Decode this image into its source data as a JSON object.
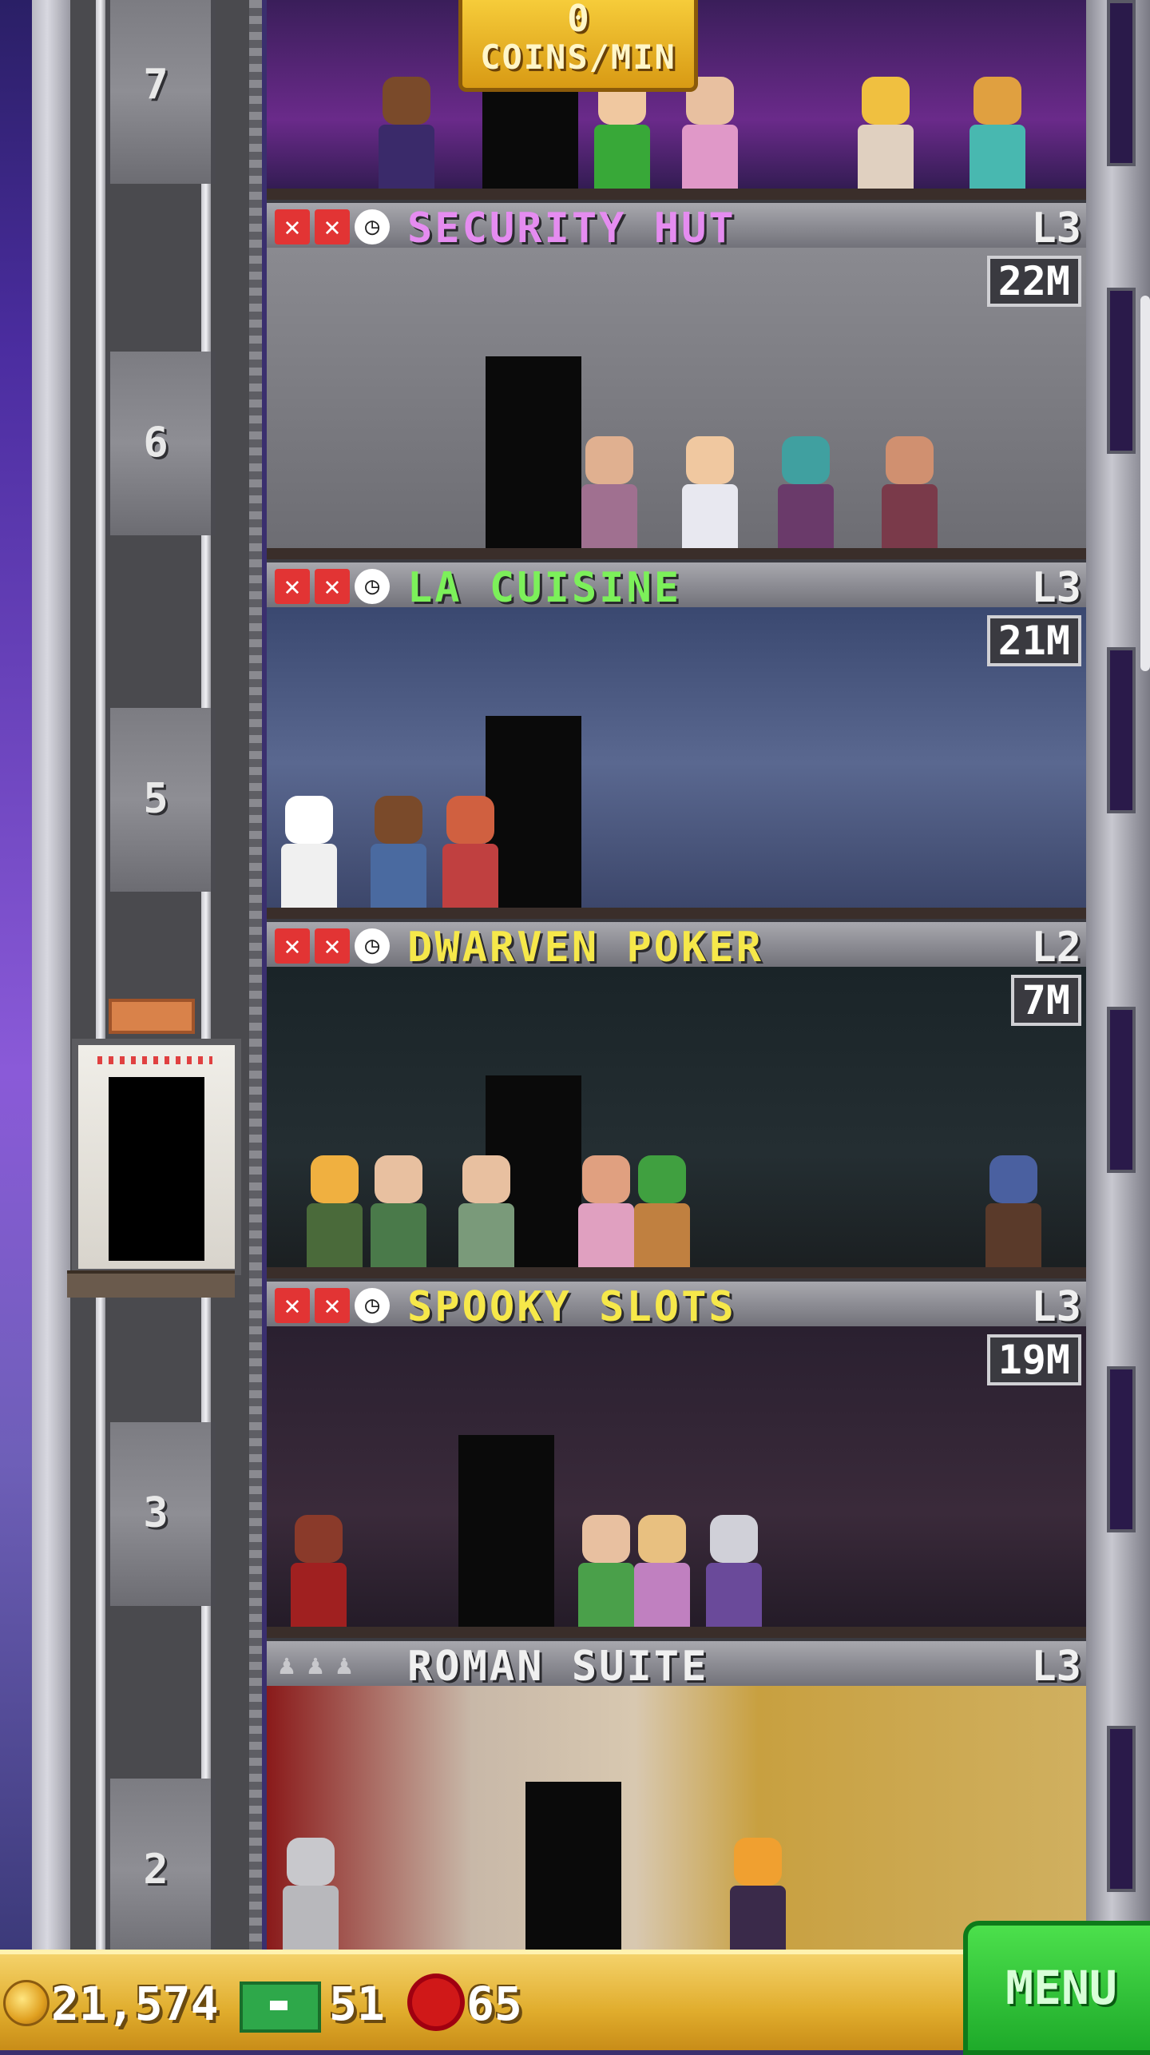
{
  "top_room": {
    "rate_value": "0",
    "rate_unit": "COINS/MIN"
  },
  "floors": [
    {
      "number": "7"
    },
    {
      "number": "6"
    },
    {
      "number": "5"
    },
    {
      "number": "3"
    },
    {
      "number": "2"
    }
  ],
  "rooms": [
    {
      "name": "SECURITY HUT",
      "level": "L3",
      "stock": "22M",
      "name_color": "#e58cf0",
      "scene_color": "#6c6c72"
    },
    {
      "name": "LA CUISINE",
      "level": "L3",
      "stock": "21M",
      "name_color": "#7cf05a",
      "scene_color": "#4a5880"
    },
    {
      "name": "DWARVEN POKER",
      "level": "L2",
      "stock": "7M",
      "name_color": "#f6e84a",
      "scene_color": "#1e2426"
    },
    {
      "name": "SPOOKY SLOTS",
      "level": "L3",
      "stock": "19M",
      "name_color": "#f6e84a",
      "scene_color": "#2a2030"
    },
    {
      "name": "ROMAN SUITE",
      "level": "L3",
      "name_color": "#f0f0f0",
      "scene_color": "#c8a070"
    }
  ],
  "status_bar": {
    "coins": "21,574",
    "bux": "51",
    "gems": "65",
    "menu_label": "MENU"
  },
  "colors": {
    "accent_gold": "#e0ac2c",
    "menu_green": "#1eaa2a",
    "alert_red": "#e23434"
  }
}
